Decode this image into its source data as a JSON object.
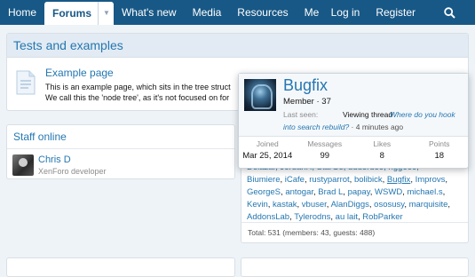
{
  "nav": {
    "tabs": [
      {
        "label": "Home"
      },
      {
        "label": "Forums"
      },
      {
        "label": "What's new"
      },
      {
        "label": "Media"
      },
      {
        "label": "Resources"
      },
      {
        "label": "Me"
      }
    ],
    "login": "Log in",
    "register": "Register",
    "dropdown_glyph": "▼"
  },
  "tests_block": {
    "title": "Tests and examples",
    "node_title": "Example page",
    "desc_line1": "This is an example page, which sits in the tree struct",
    "desc_line2": "We call this the 'node tree', as it's not focused on for"
  },
  "staff_block": {
    "title": "Staff online",
    "name": "Chris D",
    "role": "XenForo developer"
  },
  "members_block": {
    "partial_line": "Delazar, JordanH, StarGo, dduerdoo, ngg666,",
    "members": [
      "Biumiere",
      "iCafe",
      "rustyparrot",
      "bolibick",
      "Bugfix",
      "Improvs",
      "GeorgeS",
      "antogar",
      "Brad L",
      "papay",
      "WSWD",
      "michael.s",
      "Kevin",
      "kastak",
      "vbuser",
      "AlanDiggs",
      "ososusy",
      "marquisite",
      "AddonsLab",
      "Tylerodns",
      "au lait",
      "RobParker"
    ],
    "totals": "Total: 531 (members: 43, guests: 488)"
  },
  "tooltip": {
    "username": "Bugfix",
    "member_line": "Member · 37",
    "last_seen_label": "Last seen:",
    "last_seen_value": "Viewing thread",
    "last_seen_link": "Where do you hook",
    "link_line2": "into search rebuild?",
    "time_ago": " · 4 minutes ago",
    "stats": [
      {
        "label": "Joined",
        "value": "Mar 25, 2014"
      },
      {
        "label": "Messages",
        "value": "99"
      },
      {
        "label": "Likes",
        "value": "8"
      },
      {
        "label": "Points",
        "value": "18"
      }
    ]
  },
  "colors": {
    "nav": "#185886",
    "link": "#2577b1",
    "header_bg": "#e2ebf3",
    "page_bg": "#eef3f7"
  },
  "icons": {
    "search": "search-icon",
    "page": "document-icon"
  }
}
